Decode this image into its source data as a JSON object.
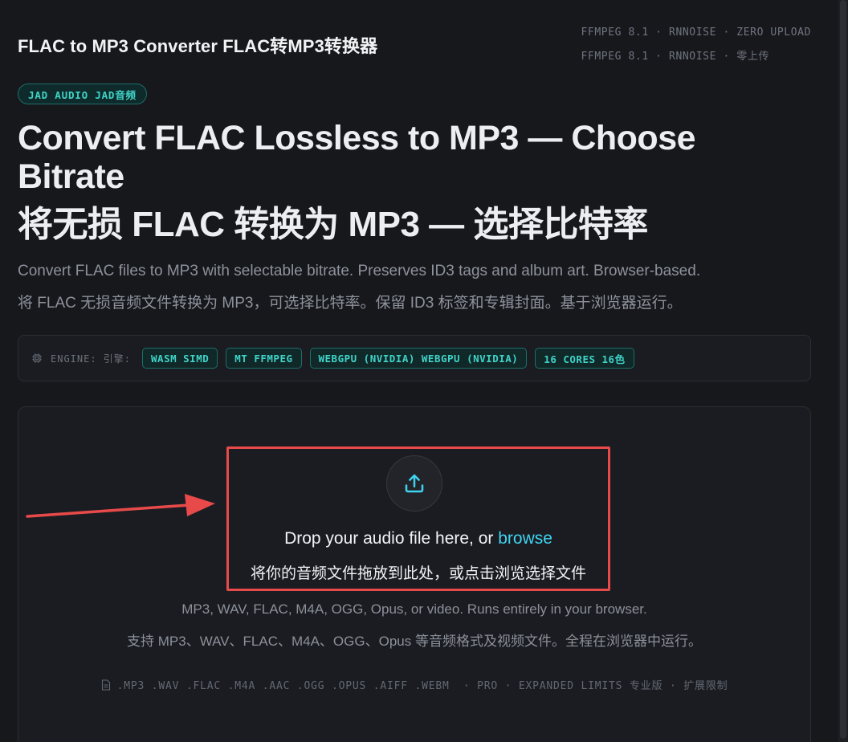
{
  "header": {
    "title": "FLAC to MP3 Converter FLAC转MP3转换器",
    "meta_en": "FFMPEG 8.1 · RNNOISE · ZERO UPLOAD",
    "meta_zh": "FFMPEG 8.1 · RNNOISE · 零上传"
  },
  "badge": "JAD AUDIO JAD音频",
  "hero": {
    "title_en": "Convert FLAC Lossless to MP3 — Choose Bitrate",
    "title_zh": "将无损 FLAC 转换为 MP3 — 选择比特率",
    "subtitle_en": "Convert FLAC files to MP3 with selectable bitrate. Preserves ID3 tags and album art. Browser-based.",
    "subtitle_zh": "将 FLAC 无损音频文件转换为 MP3，可选择比特率。保留 ID3 标签和专辑封面。基于浏览器运行。"
  },
  "engine": {
    "label": "ENGINE: 引擎:",
    "tags": [
      "WASM SIMD",
      "MT FFMPEG",
      "WEBGPU (NVIDIA) WEBGPU (NVIDIA)",
      "16 CORES 16色"
    ]
  },
  "dropzone": {
    "title_prefix": "Drop your audio file here, or ",
    "browse": "browse",
    "title_zh": "将你的音频文件拖放到此处，或点击浏览选择文件",
    "formats_en": "MP3, WAV, FLAC, M4A, OGG, Opus, or video. Runs entirely in your browser.",
    "formats_zh": "支持 MP3、WAV、FLAC、M4A、OGG、Opus 等音频格式及视频文件。全程在浏览器中运行。",
    "extensions": ".MP3 .WAV .FLAC .M4A .AAC .OGG .OPUS .AIFF .WEBM  · PRO · EXPANDED LIMITS 专业版 · 扩展限制"
  },
  "colors": {
    "accent": "#3fd3c8",
    "link": "#3fd3f0",
    "highlight": "#e84a4a",
    "background": "#17181c"
  },
  "icons": {
    "engine": "chip-icon",
    "upload": "upload-icon",
    "file": "file-icon",
    "annotation": "red-arrow-icon"
  }
}
